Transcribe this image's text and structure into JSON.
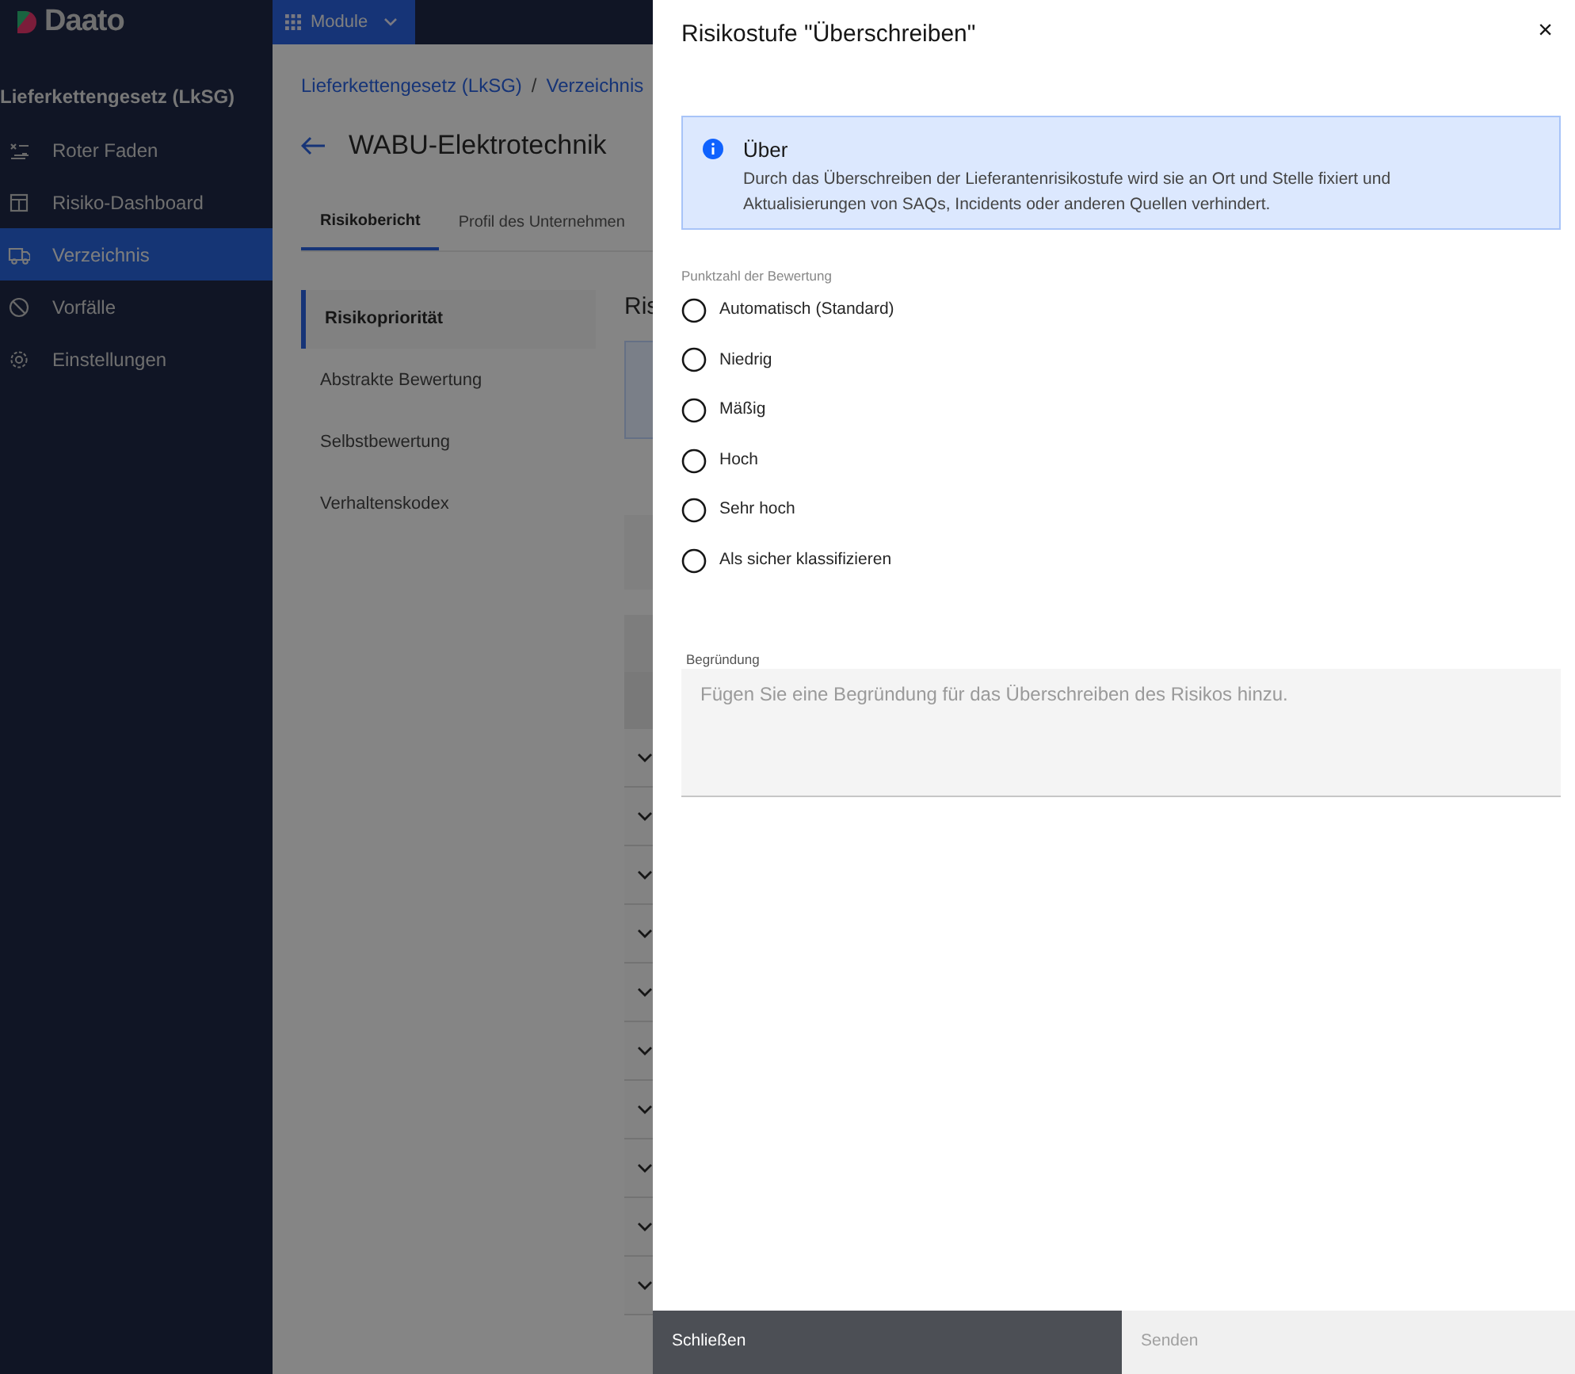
{
  "app": {
    "logo": "Daato",
    "module_button": "Module"
  },
  "sidebar": {
    "title": "Lieferkettengesetz (LkSG)",
    "items": [
      {
        "label": "Roter Faden",
        "selected": false
      },
      {
        "label": "Risiko-Dashboard",
        "selected": false
      },
      {
        "label": "Verzeichnis",
        "selected": true
      },
      {
        "label": "Vorfälle",
        "selected": false
      },
      {
        "label": "Einstellungen",
        "selected": false
      }
    ]
  },
  "main": {
    "breadcrumbs": [
      "Lieferkettengesetz (LkSG)",
      "Verzeichnis"
    ],
    "breadcrumb_separator": "/",
    "title": "WABU-Elektrotechnik",
    "tabs": [
      {
        "label": "Risikobericht",
        "selected": true
      },
      {
        "label": "Profil des Unternehmen",
        "selected": false
      }
    ],
    "side_nav": [
      {
        "label": "Risikopriorität",
        "selected": true
      },
      {
        "label": "Abstrakte Bewertung",
        "selected": false
      },
      {
        "label": "Selbstbewertung",
        "selected": false
      },
      {
        "label": "Verhaltenskodex",
        "selected": false
      }
    ],
    "section_heading": "Ris",
    "rows": [
      {
        "expanded": false
      },
      {
        "expanded": false
      },
      {
        "expanded": false
      },
      {
        "expanded": false
      },
      {
        "expanded": false
      },
      {
        "expanded": false
      },
      {
        "expanded": false
      },
      {
        "expanded": false
      },
      {
        "expanded": false
      },
      {
        "expanded": false
      }
    ]
  },
  "drawer": {
    "title": "Risikostufe \"Überschreiben\"",
    "close": "×",
    "notification": {
      "title": "Über",
      "text": "Durch das Überschreiben der Lieferantenrisikostufe wird sie an Ort und Stelle fixiert und Aktualisierungen von SAQs, Incidents oder anderen Quellen verhindert."
    },
    "radio_group": {
      "label": "Punktzahl der Bewertung",
      "options": [
        {
          "label": "Automatisch (Standard)",
          "selected": false
        },
        {
          "label": "Niedrig",
          "selected": false
        },
        {
          "label": "Mäßig",
          "selected": false
        },
        {
          "label": "Hoch",
          "selected": false
        },
        {
          "label": "Sehr hoch",
          "selected": false
        },
        {
          "label": "Als sicher klassifizieren",
          "selected": false
        }
      ]
    },
    "reason": {
      "label": "Begründung",
      "placeholder": "Fügen Sie eine Begründung für das Überschreiben des Risikos hinzu."
    },
    "buttons": [
      {
        "label": "Schließen",
        "kind": "secondary",
        "disabled": false
      },
      {
        "label": "Senden",
        "kind": "primary",
        "disabled": true
      }
    ]
  }
}
